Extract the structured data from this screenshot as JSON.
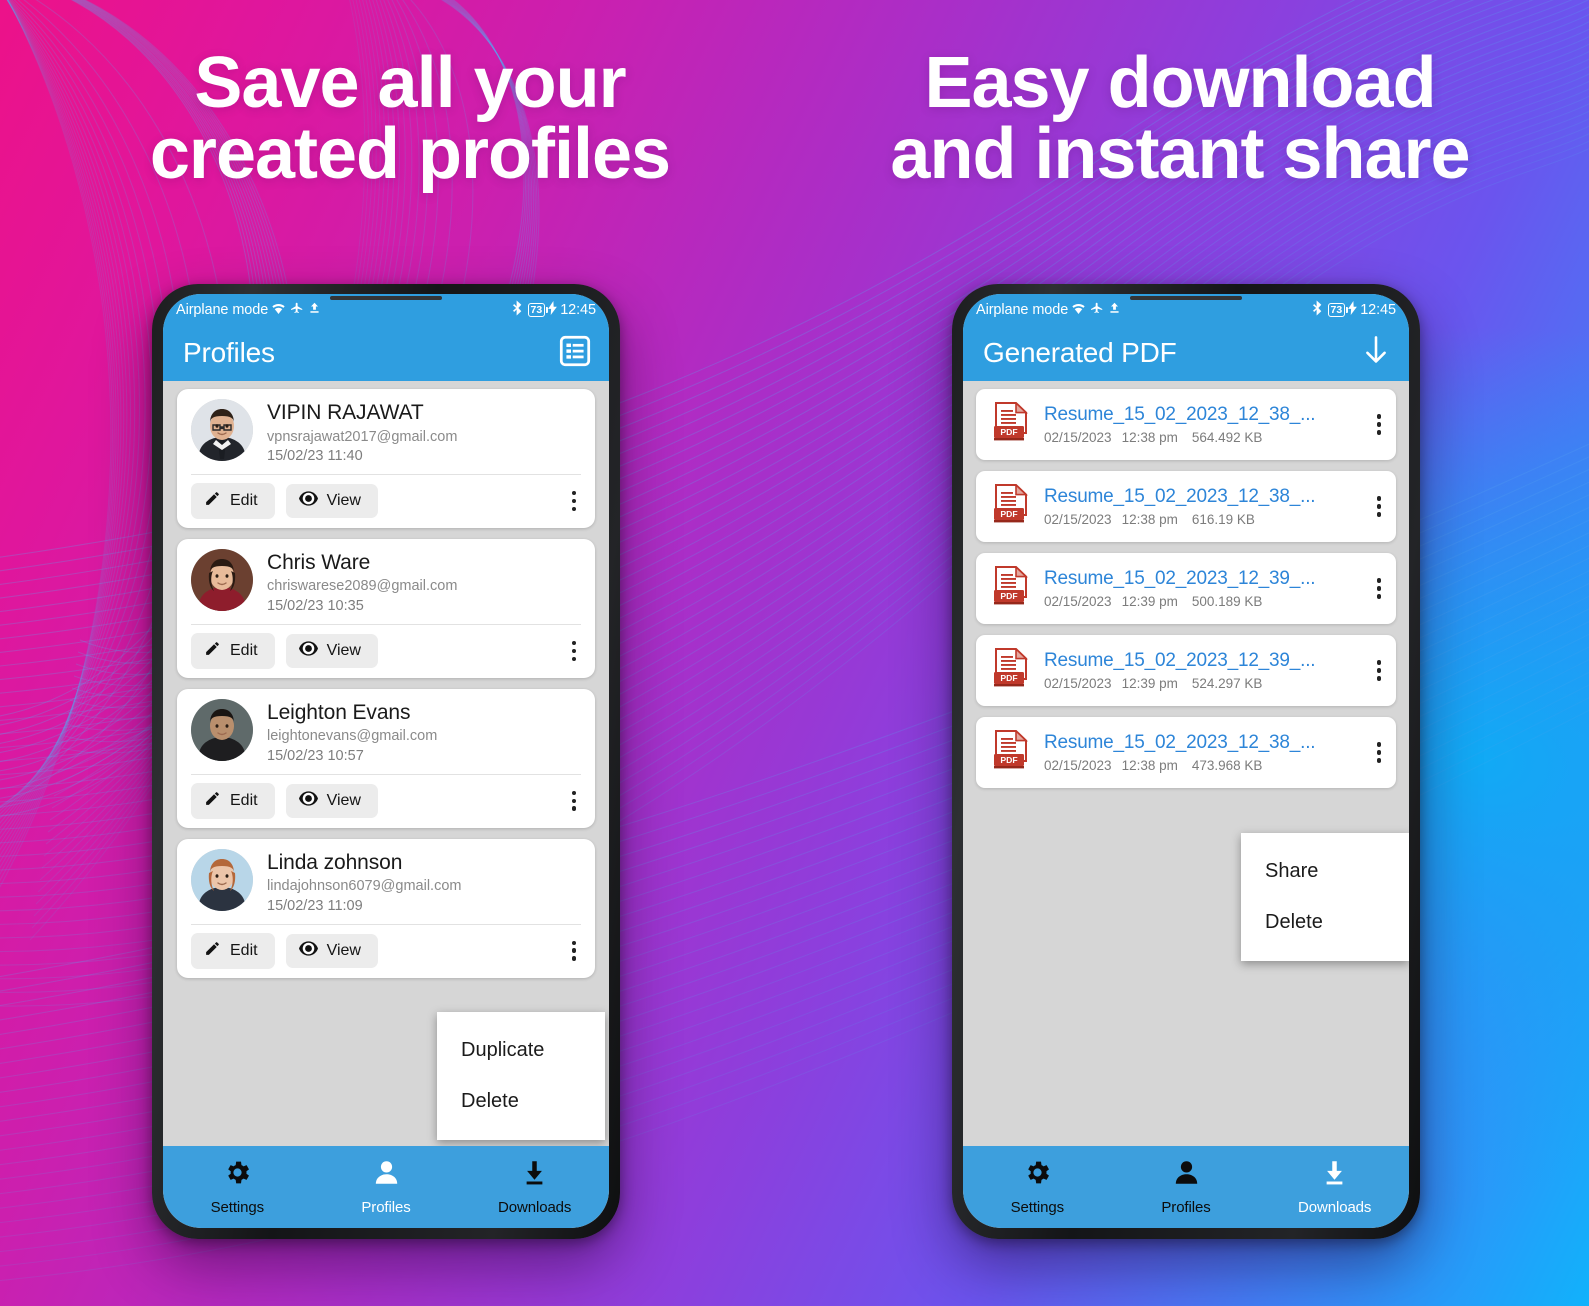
{
  "promo": {
    "headline_left": {
      "line1": "Save all your",
      "line2": "created profiles"
    },
    "headline_right": {
      "line1": "Easy download",
      "line2": "and instant share"
    }
  },
  "status_bar": {
    "airplane_text": "Airplane mode",
    "wifi_icon": "wifi-icon",
    "airplane_icon": "airplane-icon",
    "upload_icon": "upload-icon",
    "bluetooth_icon": "bluetooth-icon",
    "battery_level": "73",
    "charging_icon": "charging-bolt-icon",
    "time": "12:45"
  },
  "left_phone": {
    "appbar": {
      "title": "Profiles",
      "action_icon": "list-view-icon"
    },
    "profiles": [
      {
        "name": "VIPIN RAJAWAT",
        "email": "vpnsrajawat2017@gmail.com",
        "date": "15/02/23 11:40",
        "edit_label": "Edit",
        "view_label": "View"
      },
      {
        "name": "Chris Ware",
        "email": "chriswarese2089@gmail.com",
        "date": "15/02/23 10:35",
        "edit_label": "Edit",
        "view_label": "View"
      },
      {
        "name": "Leighton Evans",
        "email": "leightonevans@gmail.com",
        "date": "15/02/23 10:57",
        "edit_label": "Edit",
        "view_label": "View"
      },
      {
        "name": "Linda zohnson",
        "email": "lindajohnson6079@gmail.com",
        "date": "15/02/23 11:09",
        "edit_label": "Edit",
        "view_label": "View"
      }
    ],
    "context_menu": {
      "items": [
        "Duplicate",
        "Delete"
      ]
    },
    "bottom_nav": [
      {
        "label": "Settings",
        "icon": "gear-icon",
        "active": false
      },
      {
        "label": "Profiles",
        "icon": "person-icon",
        "active": true
      },
      {
        "label": "Downloads",
        "icon": "download-icon",
        "active": false
      }
    ]
  },
  "right_phone": {
    "appbar": {
      "title": "Generated PDF",
      "action_icon": "download-arrow-icon"
    },
    "files": [
      {
        "name": "Resume_15_02_2023_12_38_...",
        "date": "02/15/2023",
        "time": "12:38 pm",
        "size": "564.492 KB"
      },
      {
        "name": "Resume_15_02_2023_12_38_...",
        "date": "02/15/2023",
        "time": "12:38 pm",
        "size": "616.19 KB"
      },
      {
        "name": "Resume_15_02_2023_12_39_...",
        "date": "02/15/2023",
        "time": "12:39 pm",
        "size": "500.189 KB"
      },
      {
        "name": "Resume_15_02_2023_12_39_...",
        "date": "02/15/2023",
        "time": "12:39 pm",
        "size": "524.297 KB"
      },
      {
        "name": "Resume_15_02_2023_12_38_...",
        "date": "02/15/2023",
        "time": "12:38 pm",
        "size": "473.968 KB"
      }
    ],
    "context_menu": {
      "items": [
        "Share",
        "Delete"
      ]
    },
    "bottom_nav": [
      {
        "label": "Settings",
        "icon": "gear-icon",
        "active": false
      },
      {
        "label": "Profiles",
        "icon": "person-icon",
        "active": false
      },
      {
        "label": "Downloads",
        "icon": "download-icon",
        "active": true
      }
    ]
  },
  "colors": {
    "appbar_blue": "#2f9ee0",
    "nav_blue": "#3d9fdd",
    "screen_bg": "#d6d6d6",
    "pdf_link": "#2d85d8",
    "pdf_icon_red": "#c0392b",
    "bg_magenta": "#ec1289",
    "bg_cyan": "#11b2fb"
  }
}
